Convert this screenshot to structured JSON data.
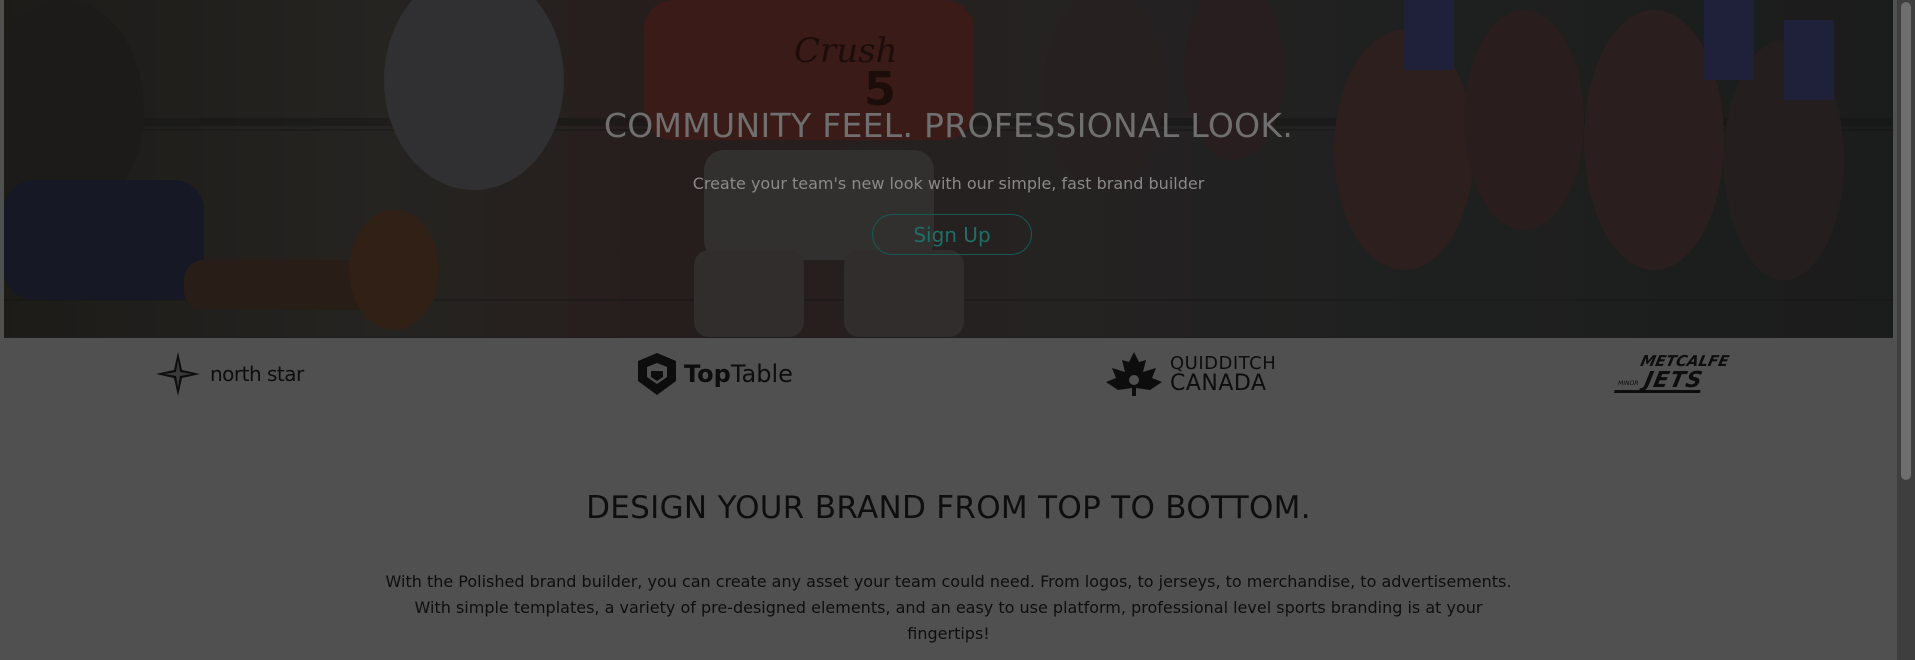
{
  "hero": {
    "title": "COMMUNITY FEEL. PROFESSIONAL LOOK.",
    "subtitle": "Create your team's new look with our simple, fast brand builder",
    "signup_label": "Sign Up",
    "background": "baseball-game-photo",
    "jersey_text": "Crush",
    "jersey_number": "5"
  },
  "logos": {
    "north_star": {
      "text": "north star",
      "icon": "compass-star-icon"
    },
    "top_table": {
      "text_bold": "Top",
      "text_light": "Table",
      "icon": "shield-icon"
    },
    "quidditch_canada": {
      "line1": "QUIDDITCH",
      "line2": "CANADA",
      "icon": "maple-leaf-icon"
    },
    "metcalfe_jets": {
      "line1": "METCALFE",
      "line2": "JETS",
      "small": "MINOR"
    }
  },
  "content": {
    "title": "DESIGN YOUR BRAND FROM TOP TO BOTTOM.",
    "body": "With the Polished brand builder, you can create any asset your team could need. From logos, to jerseys, to merchandise, to advertisements. With simple templates, a variety of pre-designed elements, and an easy to use platform, professional level sports branding is at your fingertips!"
  },
  "colors": {
    "overlay": "#505050",
    "accent_button": "#1f6e67",
    "text_dark": "#0e0e0e"
  }
}
